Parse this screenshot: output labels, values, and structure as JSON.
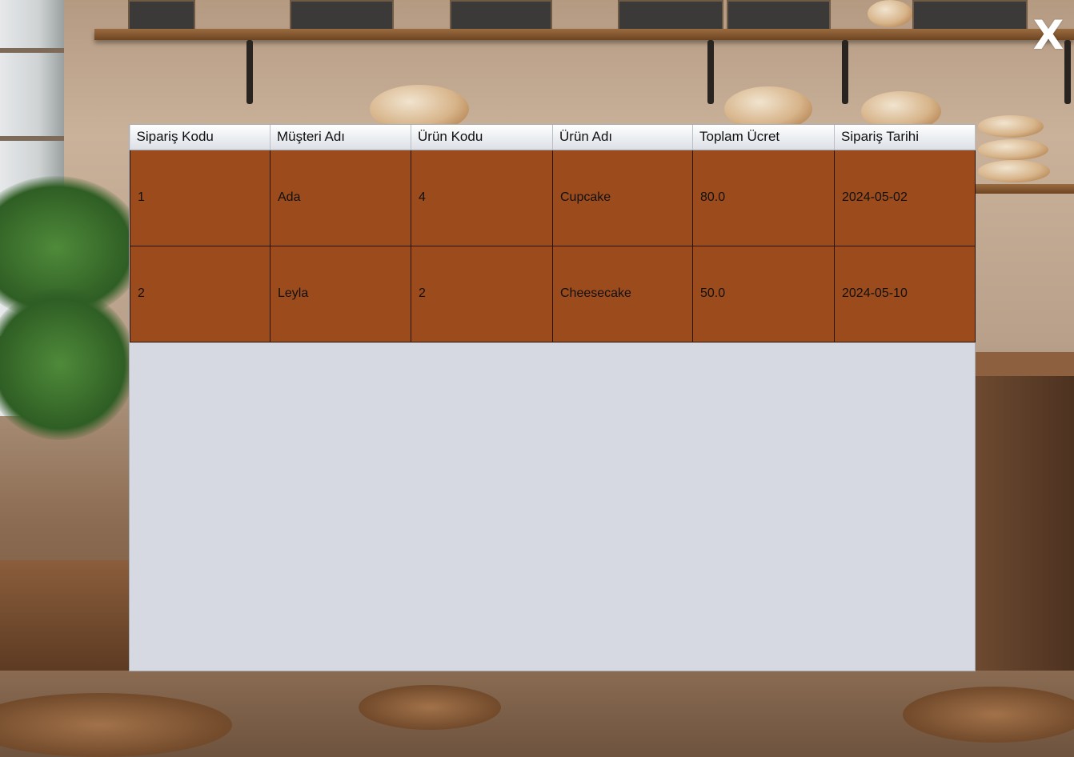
{
  "window": {
    "close_label": "X"
  },
  "colors": {
    "row_background": "#9c4b1c",
    "panel_background": "#d6d9e1",
    "header_background": "#eef0f3",
    "close_color": "#ffffff"
  },
  "table": {
    "columns": [
      {
        "label": "Sipariş Kodu"
      },
      {
        "label": "Müşteri Adı"
      },
      {
        "label": "Ürün Kodu"
      },
      {
        "label": "Ürün Adı"
      },
      {
        "label": "Toplam Ücret"
      },
      {
        "label": "Sipariş Tarihi"
      }
    ],
    "rows": [
      {
        "cells": [
          "1",
          "Ada",
          "4",
          "Cupcake",
          "80.0",
          "2024-05-02"
        ]
      },
      {
        "cells": [
          "2",
          "Leyla",
          "2",
          "Cheesecake",
          "50.0",
          "2024-05-10"
        ]
      }
    ]
  }
}
